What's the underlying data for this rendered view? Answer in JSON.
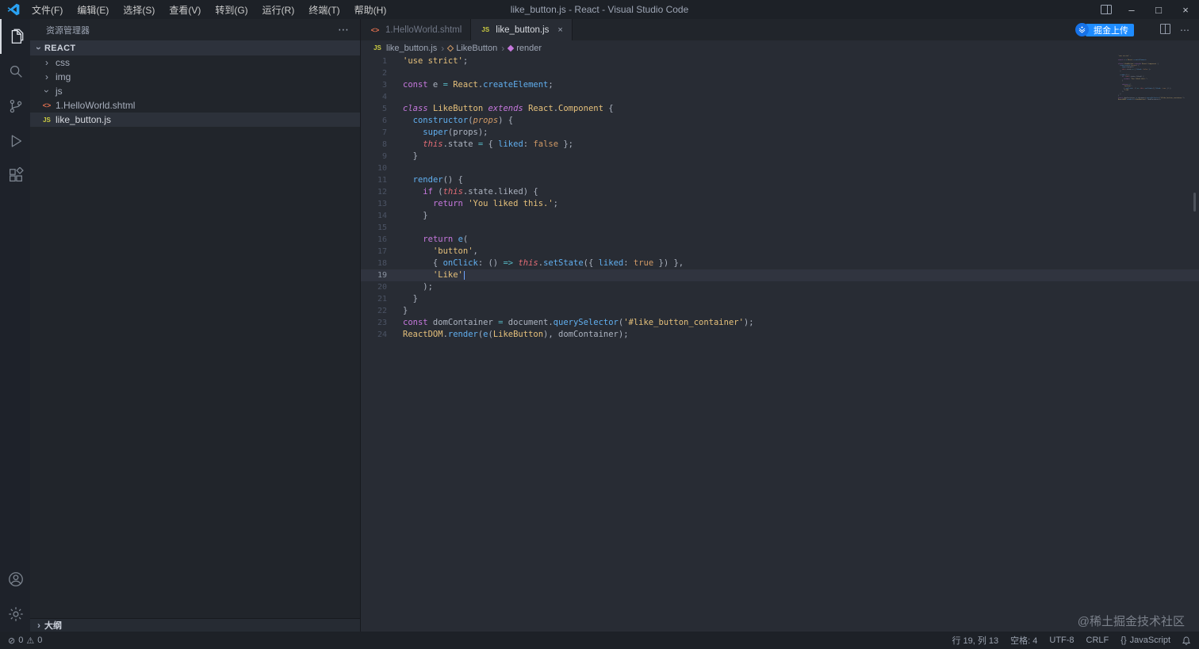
{
  "colors": {
    "accent_blue": "#1e8cff",
    "editor_bg": "#282c34",
    "sidebar_bg": "#21252b",
    "keyword_purple": "#c678dd",
    "string_yellow": "#e5c07b",
    "function_blue": "#61afef"
  },
  "icons": {
    "chevron": "›",
    "more": "⋯",
    "close": "×",
    "minimize": "–",
    "maximize": "□",
    "braces": "{}",
    "error": "⊘",
    "warning": "⚠",
    "js_badge": "JS",
    "shtml_badge": "<>"
  },
  "title_bar": {
    "menus": [
      "文件(F)",
      "编辑(E)",
      "选择(S)",
      "查看(V)",
      "转到(G)",
      "运行(R)",
      "终端(T)",
      "帮助(H)"
    ],
    "title": "like_button.js - React - Visual Studio Code"
  },
  "sidebar": {
    "title": "资源管理器",
    "section": "REACT",
    "items": [
      {
        "label": "css",
        "type": "folder",
        "expanded": false
      },
      {
        "label": "img",
        "type": "folder",
        "expanded": false
      },
      {
        "label": "js",
        "type": "folder",
        "expanded": true
      },
      {
        "label": "1.HelloWorld.shtml",
        "type": "shtml"
      },
      {
        "label": "like_button.js",
        "type": "js",
        "selected": true
      }
    ],
    "outline_label": "大纲"
  },
  "editor_tabs": [
    {
      "label": "1.HelloWorld.shtml",
      "icon": "shtml",
      "active": false,
      "closable": false
    },
    {
      "label": "like_button.js",
      "icon": "js",
      "active": true,
      "closable": true
    }
  ],
  "upload_button": {
    "label": "掘金上传"
  },
  "breadcrumb": [
    {
      "label": "like_button.js",
      "icon": "js"
    },
    {
      "label": "LikeButton",
      "icon": "class"
    },
    {
      "label": "render",
      "icon": "method"
    }
  ],
  "editor": {
    "current_line": 19,
    "lines": [
      {
        "n": 1,
        "segs": [
          [
            "s",
            "'use strict'"
          ],
          [
            "p",
            ";"
          ]
        ]
      },
      {
        "n": 2,
        "segs": []
      },
      {
        "n": 3,
        "segs": [
          [
            "k",
            "const"
          ],
          [
            "p",
            " e "
          ],
          [
            "o",
            "="
          ],
          [
            "p",
            " "
          ],
          [
            "c",
            "React"
          ],
          [
            "p",
            "."
          ],
          [
            "f",
            "createElement"
          ],
          [
            "p",
            ";"
          ]
        ]
      },
      {
        "n": 4,
        "segs": []
      },
      {
        "n": 5,
        "segs": [
          [
            "ki",
            "class"
          ],
          [
            "p",
            " "
          ],
          [
            "c",
            "LikeButton"
          ],
          [
            "p",
            " "
          ],
          [
            "ki",
            "extends"
          ],
          [
            "p",
            " "
          ],
          [
            "c",
            "React"
          ],
          [
            "p",
            "."
          ],
          [
            "c",
            "Component"
          ],
          [
            "p",
            " {"
          ]
        ]
      },
      {
        "n": 6,
        "segs": [
          [
            "p",
            "  "
          ],
          [
            "f",
            "constructor"
          ],
          [
            "p",
            "("
          ],
          [
            "pr",
            "props"
          ],
          [
            "p",
            ") {"
          ]
        ]
      },
      {
        "n": 7,
        "segs": [
          [
            "p",
            "    "
          ],
          [
            "f",
            "super"
          ],
          [
            "p",
            "(props);"
          ]
        ]
      },
      {
        "n": 8,
        "segs": [
          [
            "p",
            "    "
          ],
          [
            "th",
            "this"
          ],
          [
            "p",
            ".state "
          ],
          [
            "o",
            "="
          ],
          [
            "p",
            " { "
          ],
          [
            "key",
            "liked"
          ],
          [
            "p",
            ": "
          ],
          [
            "num",
            "false"
          ],
          [
            "p",
            " };"
          ]
        ]
      },
      {
        "n": 9,
        "segs": [
          [
            "p",
            "  }"
          ]
        ]
      },
      {
        "n": 10,
        "segs": []
      },
      {
        "n": 11,
        "segs": [
          [
            "p",
            "  "
          ],
          [
            "f",
            "render"
          ],
          [
            "p",
            "() {"
          ]
        ]
      },
      {
        "n": 12,
        "segs": [
          [
            "p",
            "    "
          ],
          [
            "k",
            "if"
          ],
          [
            "p",
            " ("
          ],
          [
            "th",
            "this"
          ],
          [
            "p",
            ".state.liked) {"
          ]
        ]
      },
      {
        "n": 13,
        "segs": [
          [
            "p",
            "      "
          ],
          [
            "k",
            "return"
          ],
          [
            "p",
            " "
          ],
          [
            "s",
            "'You liked this.'"
          ],
          [
            "p",
            ";"
          ]
        ]
      },
      {
        "n": 14,
        "segs": [
          [
            "p",
            "    }"
          ]
        ]
      },
      {
        "n": 15,
        "segs": []
      },
      {
        "n": 16,
        "segs": [
          [
            "p",
            "    "
          ],
          [
            "k",
            "return"
          ],
          [
            "p",
            " "
          ],
          [
            "f",
            "e"
          ],
          [
            "p",
            "("
          ]
        ]
      },
      {
        "n": 17,
        "segs": [
          [
            "p",
            "      "
          ],
          [
            "s",
            "'button'"
          ],
          [
            "p",
            ","
          ]
        ]
      },
      {
        "n": 18,
        "segs": [
          [
            "p",
            "      { "
          ],
          [
            "key",
            "onClick"
          ],
          [
            "p",
            ": () "
          ],
          [
            "o",
            "=>"
          ],
          [
            "p",
            " "
          ],
          [
            "th",
            "this"
          ],
          [
            "p",
            "."
          ],
          [
            "f",
            "setState"
          ],
          [
            "p",
            "({ "
          ],
          [
            "key",
            "liked"
          ],
          [
            "p",
            ": "
          ],
          [
            "num",
            "true"
          ],
          [
            "p",
            " }) },"
          ]
        ]
      },
      {
        "n": 19,
        "current": true,
        "segs": [
          [
            "p",
            "      "
          ],
          [
            "s",
            "'Like'"
          ],
          [
            "cursor",
            ""
          ]
        ]
      },
      {
        "n": 20,
        "segs": [
          [
            "p",
            "    );"
          ]
        ]
      },
      {
        "n": 21,
        "segs": [
          [
            "p",
            "  }"
          ]
        ]
      },
      {
        "n": 22,
        "segs": [
          [
            "p",
            "}"
          ]
        ]
      },
      {
        "n": 23,
        "segs": [
          [
            "k",
            "const"
          ],
          [
            "p",
            " domContainer "
          ],
          [
            "o",
            "="
          ],
          [
            "p",
            " document."
          ],
          [
            "f",
            "querySelector"
          ],
          [
            "p",
            "("
          ],
          [
            "s",
            "'#like_button_container'"
          ],
          [
            "p",
            ");"
          ]
        ]
      },
      {
        "n": 24,
        "segs": [
          [
            "c",
            "ReactDOM"
          ],
          [
            "p",
            "."
          ],
          [
            "f",
            "render"
          ],
          [
            "p",
            "("
          ],
          [
            "f",
            "e"
          ],
          [
            "p",
            "("
          ],
          [
            "c",
            "LikeButton"
          ],
          [
            "p",
            "), domContainer);"
          ]
        ]
      }
    ]
  },
  "status_bar": {
    "errors": "0",
    "warnings": "0",
    "items": [
      {
        "label": "行 19, 列 13"
      },
      {
        "label": "空格: 4"
      },
      {
        "label": "UTF-8"
      },
      {
        "label": "CRLF"
      },
      {
        "label": "JavaScript",
        "icon": "braces"
      }
    ]
  },
  "watermark": "@稀土掘金技术社区"
}
